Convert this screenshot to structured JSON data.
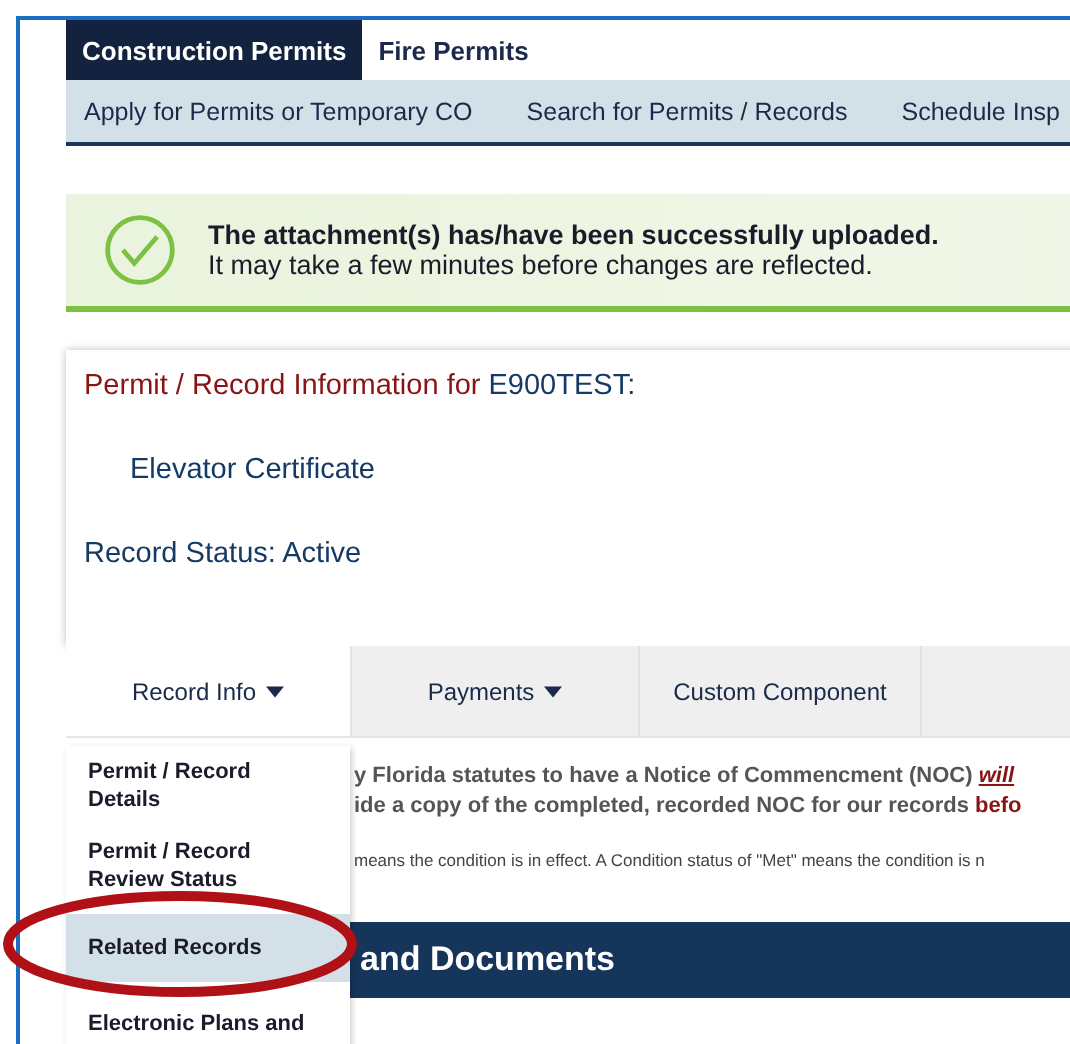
{
  "primary_tabs": [
    {
      "label": "Construction Permits",
      "selected": true
    },
    {
      "label": "Fire Permits",
      "selected": false
    }
  ],
  "secondary_nav": [
    "Apply for Permits or Temporary CO",
    "Search for Permits / Records",
    "Schedule Insp"
  ],
  "alert": {
    "kind": "success",
    "title": "The attachment(s) has/have been successfully uploaded.",
    "message": "It may take a few minutes before changes are reflected."
  },
  "record": {
    "heading": "Permit / Record Information for",
    "record_id": "E900TEST:",
    "type": "Elevator Certificate",
    "status": "Record Status: Active"
  },
  "action_tabs": [
    {
      "label": "Record Info",
      "dropdown": true,
      "selected": true
    },
    {
      "label": "Payments",
      "dropdown": true,
      "selected": false
    },
    {
      "label": "Custom Component",
      "dropdown": false,
      "selected": false
    }
  ],
  "menu": [
    {
      "label": "Permit / Record Details",
      "selected": false
    },
    {
      "label": "Permit / Record Review Status",
      "selected": false
    },
    {
      "label": "Related Records",
      "selected": true
    },
    {
      "label": "Electronic Plans and",
      "selected": false
    }
  ],
  "notice": [
    {
      "text": "y Florida statutes to have a Notice of Commencment (NOC)",
      "emphasis": "will"
    },
    {
      "text": "ide a copy of the completed, recorded NOC for our records",
      "emphasis": "befo"
    }
  ],
  "condition_note": "means the condition is in effect.  A Condition status of \"Met\" means the condition is n",
  "section_header": "and Documents"
}
